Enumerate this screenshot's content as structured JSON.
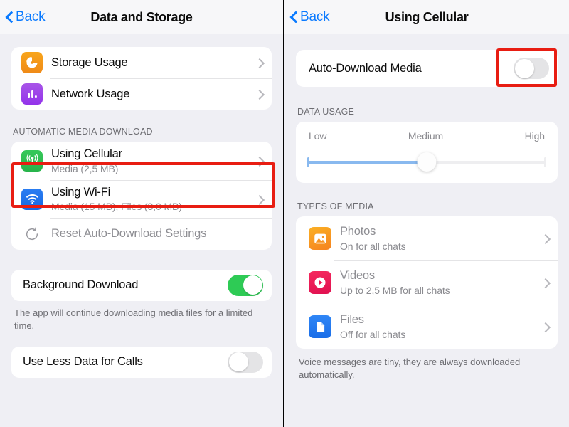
{
  "left": {
    "nav": {
      "back_label": "Back",
      "title": "Data and Storage",
      "back_icon": "chevron-left-icon"
    },
    "usage_rows": [
      {
        "title": "Storage Usage",
        "icon": "pie-chart-icon"
      },
      {
        "title": "Network Usage",
        "icon": "bar-chart-icon"
      }
    ],
    "auto_section_header": "AUTOMATIC MEDIA DOWNLOAD",
    "auto_rows": [
      {
        "title": "Using Cellular",
        "subtitle": "Media (2,5 MB)",
        "icon": "cellular-antenna-icon"
      },
      {
        "title": "Using Wi-Fi",
        "subtitle": "Media (15 MB), Files (3,0 MB)",
        "icon": "wifi-icon"
      }
    ],
    "reset_row": {
      "title": "Reset Auto-Download Settings",
      "icon": "rotate-counterclockwise-icon"
    },
    "background_download": {
      "label": "Background Download",
      "state": "on"
    },
    "background_footnote": "The app will continue downloading media files for a limited time.",
    "less_data": {
      "label": "Use Less Data for Calls",
      "state": "off"
    }
  },
  "right": {
    "nav": {
      "back_label": "Back",
      "title": "Using Cellular",
      "back_icon": "chevron-left-icon"
    },
    "auto_download": {
      "label": "Auto-Download Media",
      "state": "off"
    },
    "data_usage_header": "DATA USAGE",
    "slider": {
      "labels": [
        "Low",
        "Medium",
        "High"
      ],
      "value_label": "Medium",
      "percent": 50
    },
    "types_header": "TYPES OF MEDIA",
    "media_rows": [
      {
        "title": "Photos",
        "subtitle": "On for all chats",
        "icon": "photo-image-icon"
      },
      {
        "title": "Videos",
        "subtitle": "Up to 2,5 MB for all chats",
        "icon": "video-play-icon"
      },
      {
        "title": "Files",
        "subtitle": "Off for all chats",
        "icon": "document-file-icon"
      }
    ],
    "footnote": "Voice messages are tiny, they are always downloaded automatically."
  },
  "highlights": {
    "color": "#e81d12",
    "left_target": "using-cellular-row",
    "right_target": "auto-download-media-toggle"
  }
}
